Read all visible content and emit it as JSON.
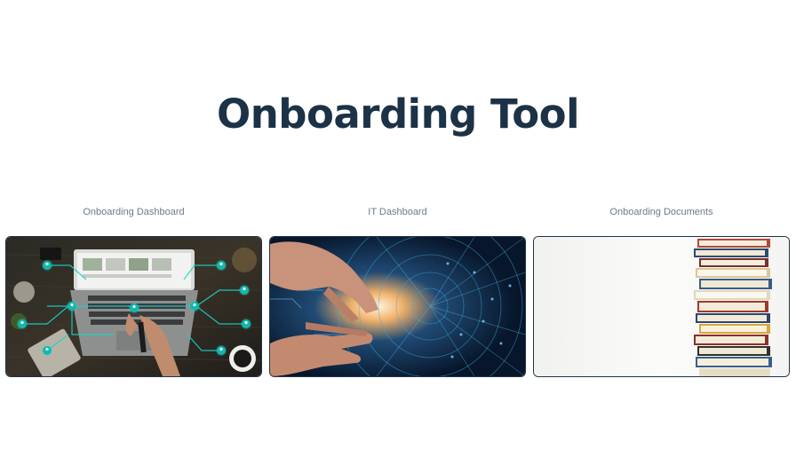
{
  "page": {
    "title": "Onboarding Tool"
  },
  "cards": [
    {
      "label": "Onboarding Dashboard",
      "image": "laptop-network-photo"
    },
    {
      "label": "IT Dashboard",
      "image": "digital-hands-photo"
    },
    {
      "label": "Onboarding Documents",
      "image": "book-stack-photo"
    }
  ],
  "colors": {
    "title": "#1b3247",
    "label": "#6c7a88",
    "card_border": "#1f3349",
    "network_accent": "#19d4c8",
    "digital_accent": "#3aa8e0"
  }
}
